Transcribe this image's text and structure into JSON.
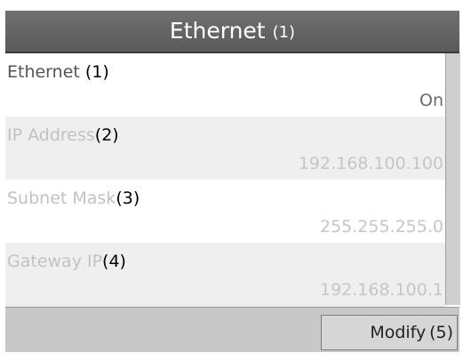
{
  "header": {
    "title": "Ethernet",
    "title_num": "(1)"
  },
  "items": [
    {
      "label": "Ethernet",
      "num": "(1)",
      "value": "On"
    },
    {
      "label": "IP Address",
      "num": "(2)",
      "value": "192.168.100.100"
    },
    {
      "label": "Subnet Mask",
      "num": "(3)",
      "value": "255.255.255.0"
    },
    {
      "label": "Gateway IP",
      "num": "(4)",
      "value": "192.168.100.1"
    }
  ],
  "footer": {
    "modify_label": "Modify",
    "modify_num": "(5)"
  }
}
